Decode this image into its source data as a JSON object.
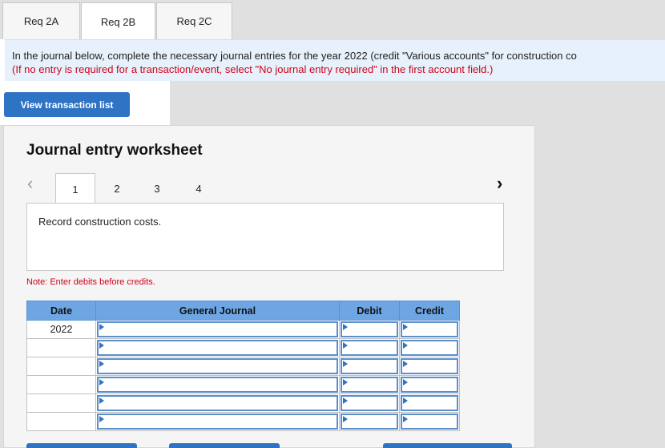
{
  "tabs": [
    {
      "label": "Req 2A"
    },
    {
      "label": "Req 2B"
    },
    {
      "label": "Req 2C"
    }
  ],
  "active_tab": "Req 2B",
  "instructions": {
    "line1": "In the journal below, complete the necessary journal entries for the year 2022 (credit \"Various accounts\" for construction co",
    "line2": "(If no entry is required for a transaction/event, select \"No journal entry required\" in the first account field.)"
  },
  "view_button": "View transaction list",
  "worksheet": {
    "title": "Journal entry worksheet",
    "steps": [
      "1",
      "2",
      "3",
      "4"
    ],
    "active_step": "1",
    "description": "Record construction costs.",
    "note": "Note: Enter debits before credits."
  },
  "journal": {
    "headers": {
      "date": "Date",
      "account": "General Journal",
      "debit": "Debit",
      "credit": "Credit"
    },
    "rows": [
      {
        "date": "2022",
        "account": "",
        "debit": "",
        "credit": ""
      },
      {
        "date": "",
        "account": "",
        "debit": "",
        "credit": ""
      },
      {
        "date": "",
        "account": "",
        "debit": "",
        "credit": ""
      },
      {
        "date": "",
        "account": "",
        "debit": "",
        "credit": ""
      },
      {
        "date": "",
        "account": "",
        "debit": "",
        "credit": ""
      },
      {
        "date": "",
        "account": "",
        "debit": "",
        "credit": ""
      }
    ]
  },
  "colors": {
    "accent": "#2f73c4",
    "header_blue": "#6ea6e4",
    "note_red": "#d0021b",
    "instr_bg": "#e6f1fb"
  },
  "icons": {
    "prev": "chevron-left-icon",
    "next": "chevron-right-icon",
    "field_marker": "triangle-right-icon"
  }
}
